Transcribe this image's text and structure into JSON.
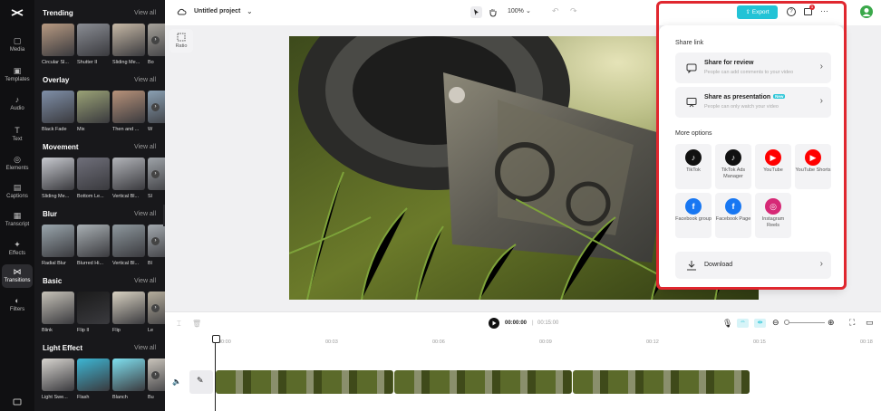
{
  "app_logo": "CapCut",
  "rail": [
    {
      "label": "Media",
      "icon": "media-icon"
    },
    {
      "label": "Templates",
      "icon": "templates-icon"
    },
    {
      "label": "Audio",
      "icon": "audio-icon"
    },
    {
      "label": "Text",
      "icon": "text-icon"
    },
    {
      "label": "Elements",
      "icon": "elements-icon"
    },
    {
      "label": "Captions",
      "icon": "captions-icon"
    },
    {
      "label": "Transcript",
      "icon": "transcript-icon"
    },
    {
      "label": "Effects",
      "icon": "effects-icon"
    },
    {
      "label": "Transitions",
      "icon": "transitions-icon"
    },
    {
      "label": "Filters",
      "icon": "filters-icon"
    }
  ],
  "library": {
    "sections": [
      {
        "title": "Trending",
        "view_all": "View all",
        "items": [
          "Circular Sl...",
          "Shutter II",
          "Sliding Me...",
          "Bo"
        ]
      },
      {
        "title": "Overlay",
        "view_all": "View all",
        "items": [
          "Black Fade",
          "Mix",
          "Then and ...",
          "W"
        ]
      },
      {
        "title": "Movement",
        "view_all": "View all",
        "items": [
          "Sliding Me...",
          "Bottom Le...",
          "Vertical Bl...",
          "Sl"
        ]
      },
      {
        "title": "Blur",
        "view_all": "View all",
        "items": [
          "Radial Blur",
          "Blurred Hi...",
          "Vertical Bl...",
          "Bl"
        ]
      },
      {
        "title": "Basic",
        "view_all": "View all",
        "items": [
          "Blink",
          "Flip II",
          "Flip",
          "Le"
        ]
      },
      {
        "title": "Light Effect",
        "view_all": "View all",
        "items": [
          "Light Swe...",
          "Flash",
          "Blanch",
          "Bu"
        ]
      }
    ]
  },
  "topbar": {
    "project_title": "Untitled project",
    "zoom": "100%",
    "export_label": "Export",
    "notification_count": "1"
  },
  "ratio_label": "Ratio",
  "share": {
    "share_link_heading": "Share link",
    "review_title": "Share for review",
    "review_sub": "People can add comments to your video",
    "presentation_title": "Share as presentation",
    "presentation_badge": "New",
    "presentation_sub": "People can only watch your video",
    "more_heading": "More options",
    "platforms": [
      {
        "name": "TikTok",
        "color": "#111111"
      },
      {
        "name": "TikTok Ads Manager",
        "color": "#111111"
      },
      {
        "name": "YouTube",
        "color": "#ff0000"
      },
      {
        "name": "YouTube Shorts",
        "color": "#ff0000"
      },
      {
        "name": "Facebook group",
        "color": "#1877f2"
      },
      {
        "name": "Facebook Page",
        "color": "#1877f2"
      },
      {
        "name": "Instagram Reels",
        "color": "#d62976"
      }
    ],
    "download_label": "Download"
  },
  "timeline": {
    "current_time": "00:00:00",
    "total_time": "00:15:00",
    "ticks": [
      "00:00",
      "00:03",
      "00:06",
      "00:09",
      "00:12",
      "00:15",
      "00:18"
    ]
  },
  "colors": {
    "accent": "#22c3d6",
    "highlight": "#e0272f"
  }
}
